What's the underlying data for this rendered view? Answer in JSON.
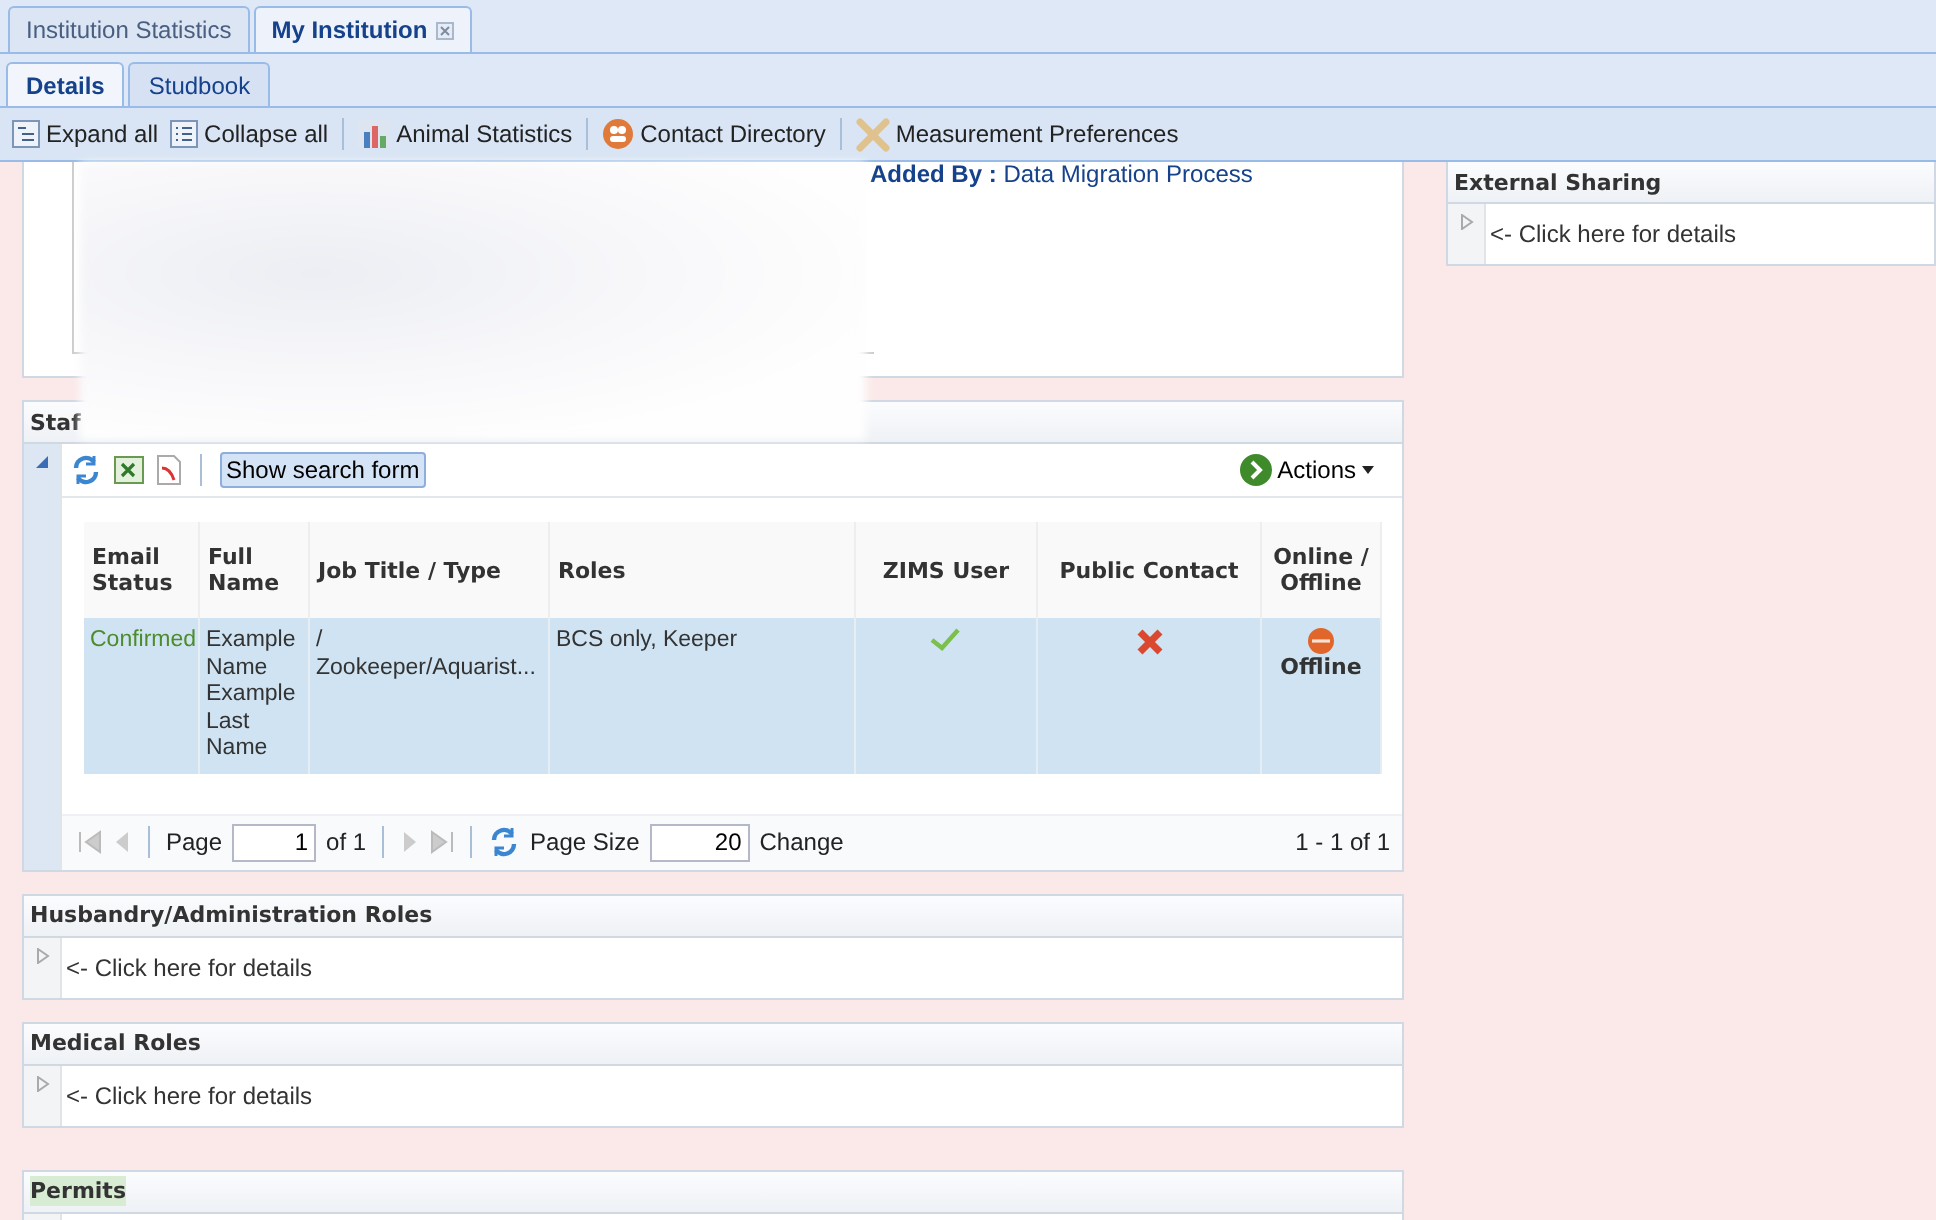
{
  "top_tabs": [
    {
      "label": "Institution Statistics",
      "selected": false,
      "closable": false
    },
    {
      "label": "My Institution",
      "selected": true,
      "closable": true
    }
  ],
  "sub_tabs": [
    {
      "label": "Details",
      "selected": true
    },
    {
      "label": "Studbook",
      "selected": false
    }
  ],
  "toolbar": [
    {
      "label": "Expand all"
    },
    {
      "label": "Collapse all"
    },
    {
      "label": "Animal Statistics"
    },
    {
      "label": "Contact Directory"
    },
    {
      "label": "Measurement Preferences"
    }
  ],
  "overview": {
    "added_by_label": "Added By :",
    "added_by_value": "Data Migration Process"
  },
  "external_sharing": {
    "title": "External Sharing",
    "hint": "<- Click here for details",
    "expanded": false
  },
  "staff": {
    "title": "Staf",
    "expanded": true,
    "search_button": "Show search form",
    "actions": "Actions",
    "columns": [
      "Email Status",
      "Full Name",
      "Job Title / Type",
      "Roles",
      "ZIMS User",
      "Public Contact",
      "Online / Offline"
    ],
    "rows": [
      {
        "email_status": "Confirmed",
        "full_name": "Example Name Example Last Name",
        "job_title": "/ Zookeeper/Aquarist...",
        "roles": "BCS only, Keeper",
        "zims_user": true,
        "public_contact": false,
        "online_status": "Offline",
        "online": false,
        "selected": true
      }
    ],
    "pager": {
      "page_label": "Page",
      "page": "1",
      "of": "of 1",
      "size_label": "Page Size",
      "size": "20",
      "change": "Change",
      "range": "1 - 1 of 1"
    }
  },
  "sections": [
    {
      "title": "Husbandry/Administration Roles",
      "hint": "<- Click here for details",
      "highlighted": false
    },
    {
      "title": "Medical Roles",
      "hint": "<- Click here for details",
      "highlighted": false
    },
    {
      "title": "Permits",
      "highlighted": true
    }
  ]
}
